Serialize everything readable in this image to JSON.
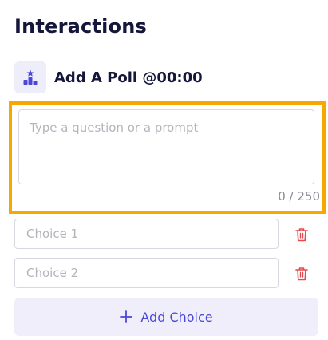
{
  "header": {
    "title": "Interactions"
  },
  "poll": {
    "title": "Add A Poll @00:00",
    "icon": "poll-bars-star-icon"
  },
  "question": {
    "placeholder": "Type a question or a prompt",
    "value": "",
    "counter": "0 / 250"
  },
  "choices": [
    {
      "placeholder": "Choice 1",
      "value": ""
    },
    {
      "placeholder": "Choice 2",
      "value": ""
    }
  ],
  "add_choice": {
    "label": "Add Choice",
    "icon": "plus-icon"
  },
  "colors": {
    "accent": "#4a47d8",
    "highlight": "#f7a800",
    "delete": "#e5484d",
    "title": "#14163a"
  }
}
